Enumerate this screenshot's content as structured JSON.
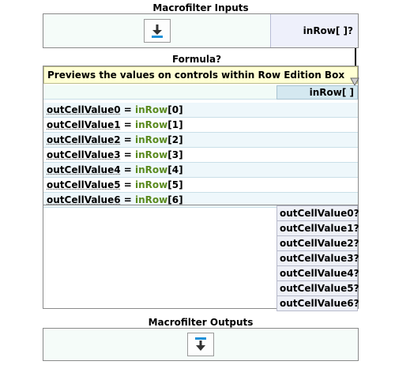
{
  "inputs": {
    "title": "Macrofilter Inputs",
    "param": "inRow[ ]?"
  },
  "formula": {
    "title": "Formula?",
    "description": "Previews the values on controls within Row Edition Box",
    "input_chip": "inRow[ ]",
    "equals": " = ",
    "rows": [
      {
        "var": "outCellValue0",
        "fn": "inRow",
        "index": "[0]"
      },
      {
        "var": "outCellValue1",
        "fn": "inRow",
        "index": "[1]"
      },
      {
        "var": "outCellValue2",
        "fn": "inRow",
        "index": "[2]"
      },
      {
        "var": "outCellValue3",
        "fn": "inRow",
        "index": "[3]"
      },
      {
        "var": "outCellValue4",
        "fn": "inRow",
        "index": "[4]"
      },
      {
        "var": "outCellValue5",
        "fn": "inRow",
        "index": "[5]"
      },
      {
        "var": "outCellValue6",
        "fn": "inRow",
        "index": "[6]"
      }
    ],
    "outputs": [
      "outCellValue0?",
      "outCellValue1?",
      "outCellValue2?",
      "outCellValue3?",
      "outCellValue4?",
      "outCellValue5?",
      "outCellValue6?"
    ]
  },
  "outputs_section": {
    "title": "Macrofilter Outputs"
  },
  "icons": {
    "inputs_icon": "arrow-down-to-bar-icon",
    "outputs_icon": "arrow-down-from-bar-icon"
  },
  "colors": {
    "icon_blue": "#1e90d8",
    "function_green": "#5a8a1e",
    "description_bg": "#ffffd4"
  }
}
